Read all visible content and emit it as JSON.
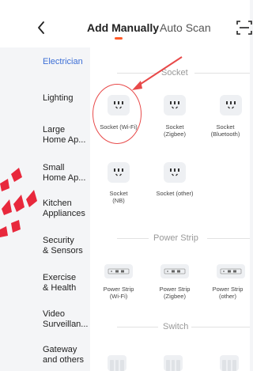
{
  "header": {
    "back_icon": "chevron-left-icon",
    "tabs": [
      {
        "label": "Add Manually",
        "active": true
      },
      {
        "label": "Auto Scan",
        "active": false
      }
    ],
    "scan_icon": "scan-frame-icon",
    "accent_color": "#ff5a28"
  },
  "sidebar": {
    "active_color": "#3d6fd6",
    "items": [
      {
        "label": "Electrician",
        "active": true
      },
      {
        "label": "Lighting",
        "active": false
      },
      {
        "label": "Large\nHome Ap...",
        "active": false
      },
      {
        "label": "Small\nHome Ap...",
        "active": false
      },
      {
        "label": "Kitchen\nAppliances",
        "active": false
      },
      {
        "label": "Security\n& Sensors",
        "active": false
      },
      {
        "label": "Exercise\n& Health",
        "active": false
      },
      {
        "label": "Video\nSurveillan...",
        "active": false
      },
      {
        "label": "Gateway\nand others",
        "active": false
      }
    ]
  },
  "sections": [
    {
      "title": "Socket",
      "devices": [
        {
          "label": "Socket (Wi-Fi)",
          "icon": "socket-icon",
          "highlighted": true
        },
        {
          "label": "Socket\n(Zigbee)",
          "icon": "socket-icon"
        },
        {
          "label": "Socket\n(Bluetooth)",
          "icon": "socket-icon"
        },
        {
          "label": "Socket\n(NB)",
          "icon": "socket-icon"
        },
        {
          "label": "Socket (other)",
          "icon": "socket-icon"
        }
      ]
    },
    {
      "title": "Power Strip",
      "devices": [
        {
          "label": "Power Strip\n(Wi-Fi)",
          "icon": "power-strip-icon"
        },
        {
          "label": "Power Strip\n(Zigbee)",
          "icon": "power-strip-icon"
        },
        {
          "label": "Power Strip\n(other)",
          "icon": "power-strip-icon"
        }
      ]
    },
    {
      "title": "Switch",
      "devices": [
        {
          "icon": "wall-switch-icon"
        },
        {
          "icon": "wall-switch-icon"
        },
        {
          "icon": "wall-switch-icon"
        }
      ]
    }
  ],
  "annotation_color": "#e84a4a"
}
